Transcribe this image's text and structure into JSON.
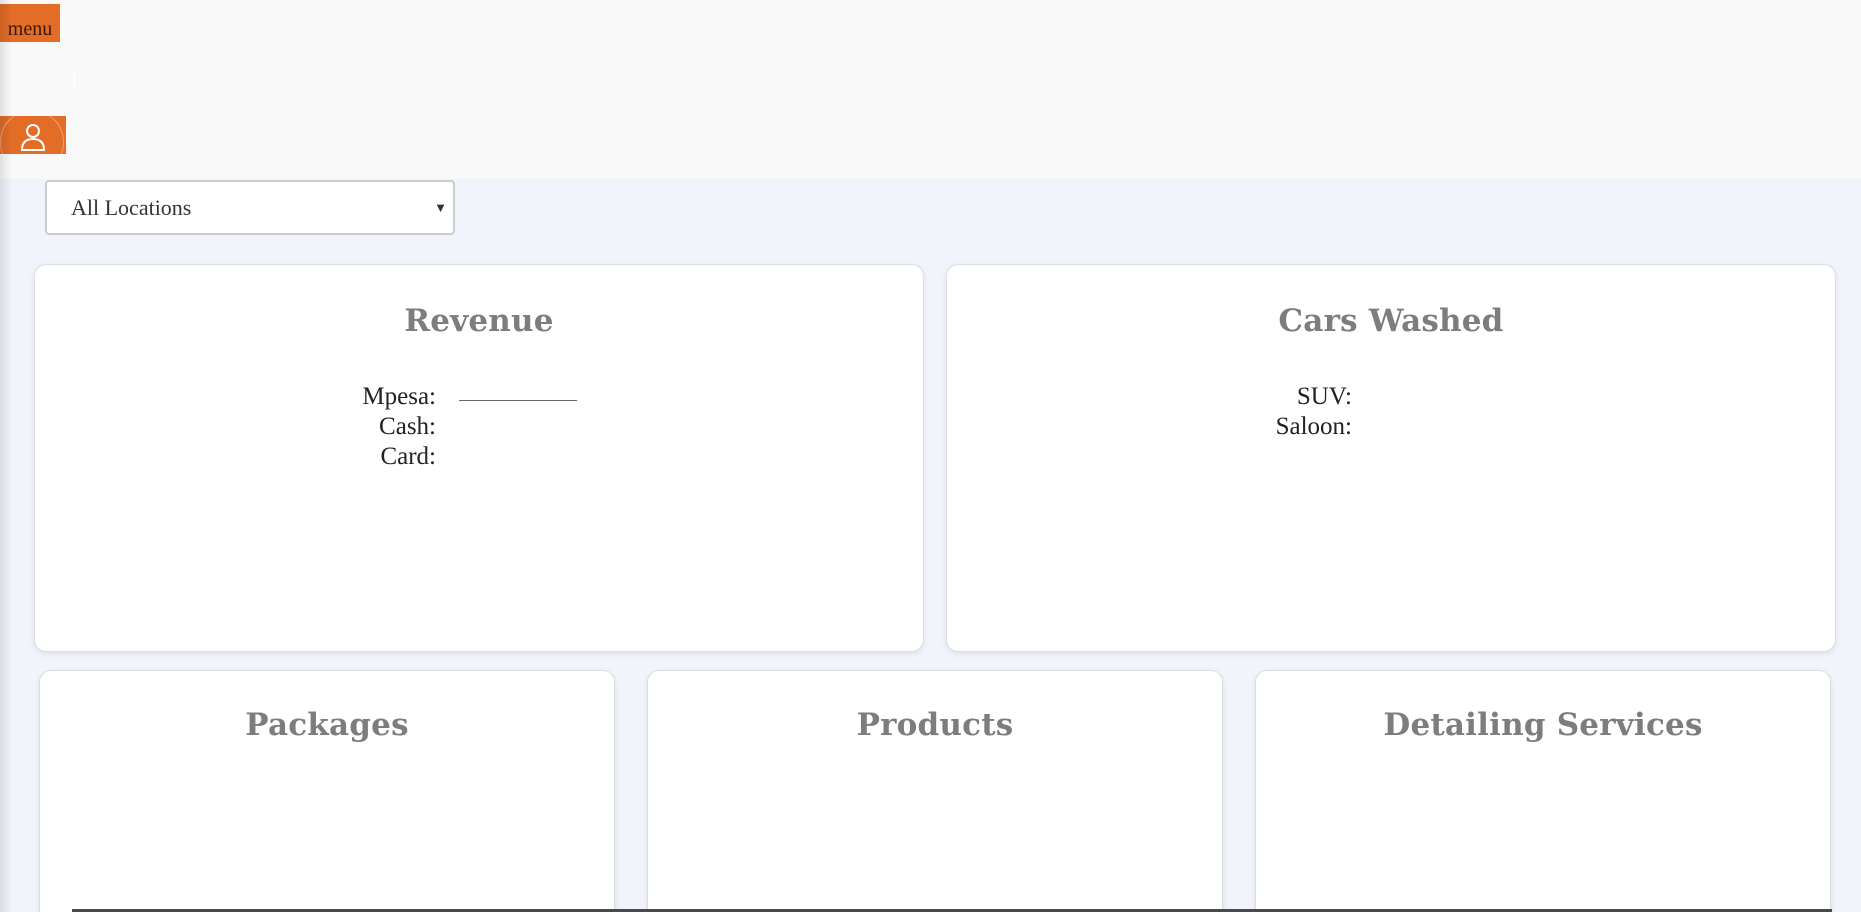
{
  "header": {
    "menu_label": "menu",
    "avatar_icon": "user-icon",
    "accent_color": "#e36c26"
  },
  "filter": {
    "location_selected": "All Locations"
  },
  "cards": {
    "revenue": {
      "title": "Revenue",
      "rows": [
        {
          "label": "Mpesa:"
        },
        {
          "label": "Cash:"
        },
        {
          "label": "Card:"
        }
      ]
    },
    "cars_washed": {
      "title": "Cars Washed",
      "rows": [
        {
          "label": "SUV:"
        },
        {
          "label": "Saloon:"
        }
      ]
    },
    "packages": {
      "title": "Packages"
    },
    "products": {
      "title": "Products"
    },
    "detailing": {
      "title": "Detailing Services"
    }
  }
}
